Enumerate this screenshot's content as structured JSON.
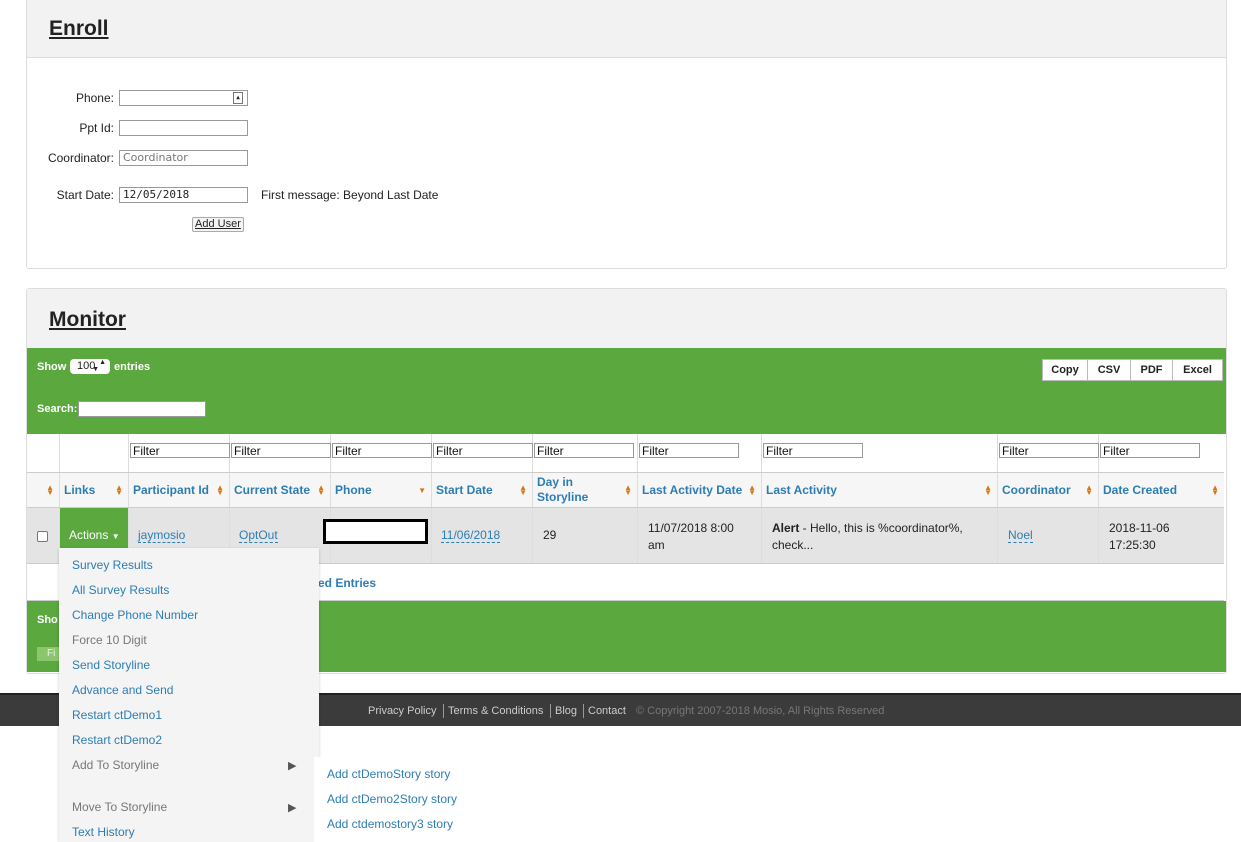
{
  "enroll": {
    "title": "Enroll",
    "phone_label": "Phone:",
    "ppt_label": "Ppt Id:",
    "coordinator_label": "Coordinator:",
    "coordinator_placeholder": "Coordinator",
    "start_label": "Start Date:",
    "start_value": "12/05/2018",
    "first_message": "First message: Beyond Last Date",
    "add_user": "Add User"
  },
  "monitor": {
    "title": "Monitor",
    "show": "Show",
    "entries_count": "100",
    "entries": "entries",
    "search_label": "Search:",
    "export_buttons": [
      "Copy",
      "CSV",
      "PDF",
      "Excel"
    ],
    "filter_placeholder": "Filter",
    "columns": [
      "Links",
      "Participant Id",
      "Current State",
      "Phone",
      "Start Date",
      "Day in Storyline",
      "Last Activity Date",
      "Last Activity",
      "Coordinator",
      "Date Created"
    ],
    "row": {
      "actions": "Actions",
      "participant": "jaymosio",
      "state": "OptOut",
      "start": "11/06/2018",
      "day": "29",
      "last_date": "11/07/2018 8:00 am",
      "last_activity_bold": "Alert",
      "last_activity_rest": " - Hello, this is %coordinator%, check...",
      "coordinator": "Noel",
      "created": "2018-11-06 17:25:30"
    },
    "selected_fragment": "ted Entries",
    "bottom_show": "Sho",
    "bottom_f": "Fi"
  },
  "actions_menu": [
    "Survey Results",
    "All Survey Results",
    "Change Phone Number",
    "Force 10 Digit",
    "Send Storyline",
    "Advance and Send",
    "Restart ctDemo1",
    "Restart ctDemo2",
    "Add To Storyline",
    "Move To Storyline",
    "Text History"
  ],
  "submenu": [
    "Add ctDemoStory story",
    "Add ctDemo2Story story",
    "Add ctdemostory3 story"
  ],
  "footer": {
    "privacy": "Privacy Policy",
    "terms": "Terms & Conditions",
    "blog": "Blog",
    "contact": "Contact",
    "copyright": "© Copyright 2007-2018 Mosio, All Rights Reserved"
  },
  "colors": {
    "green": "#5aa83e",
    "link": "#2d7db3"
  }
}
